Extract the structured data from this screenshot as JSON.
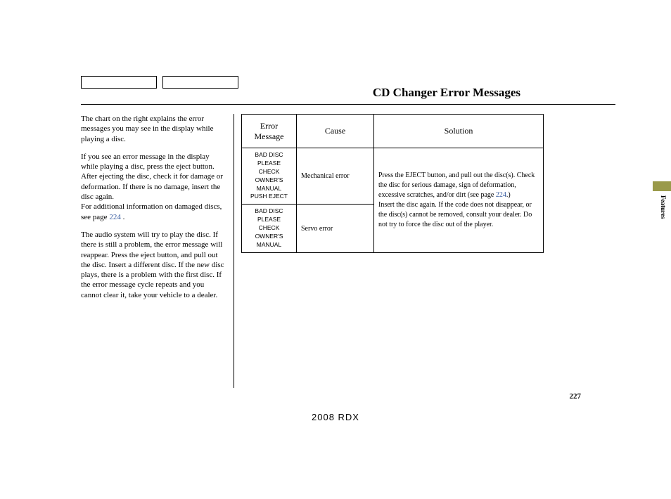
{
  "header": {
    "title": "CD Changer Error Messages"
  },
  "left": {
    "p1": "The chart on the right explains the error messages you may see in the display while playing a disc.",
    "p2": "If you see an error message in the display while playing a disc, press the eject button. After ejecting the disc, check it for damage or deformation. If there is no damage, insert the disc again.",
    "p3a": "For additional information on damaged discs, see page ",
    "p3link": "224",
    "p3b": " .",
    "p4": "The audio system will try to play the disc. If there is still a problem, the error message will reappear. Press the eject button, and pull out the disc. Insert a different disc. If the new disc plays, there is a problem with the first disc. If the error message cycle repeats and you cannot clear it, take your vehicle to a dealer."
  },
  "table": {
    "headers": {
      "err": "Error Message",
      "cause": "Cause",
      "sol": "Solution"
    },
    "rows": [
      {
        "err_lines": [
          "BAD DISC",
          "PLEASE CHECK",
          "OWNER'S",
          "MANUAL",
          "PUSH EJECT"
        ],
        "cause": "Mechanical error"
      },
      {
        "err_lines": [
          "BAD DISC",
          "PLEASE CHECK",
          "OWNER'S",
          "MANUAL"
        ],
        "cause": "Servo error"
      }
    ],
    "solution": {
      "part1": "Press the EJECT button, and pull out the disc(s). Check the disc for serious damage, sign of deformation, excessive scratches, and/or dirt (see page ",
      "link": "224",
      "part2": ".)",
      "part3": "Insert the disc again. If the code does not disappear, or the disc(s) cannot be removed, consult your dealer. Do not try to force the disc out of the player."
    }
  },
  "side": {
    "label": "Features"
  },
  "page_number": "227",
  "footer": "2008  RDX"
}
